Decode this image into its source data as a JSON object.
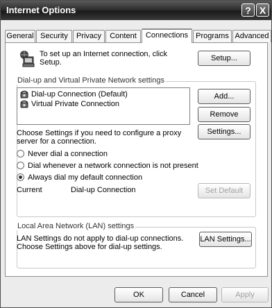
{
  "window": {
    "title": "Internet Options",
    "help_label": "?",
    "close_label": "X"
  },
  "tabs": [
    {
      "label": "General"
    },
    {
      "label": "Security"
    },
    {
      "label": "Privacy"
    },
    {
      "label": "Content"
    },
    {
      "label": "Connections",
      "active": true
    },
    {
      "label": "Programs"
    },
    {
      "label": "Advanced"
    }
  ],
  "setup": {
    "text_line1": "To set up an Internet connection, click",
    "text_line2": "Setup.",
    "button_label": "Setup..."
  },
  "dialup": {
    "group_label": "Dial-up and Virtual Private Network settings",
    "connections": [
      {
        "label": "Dial-up Connection (Default)",
        "selected": true
      },
      {
        "label": "Virtual Private Connection",
        "selected": false
      }
    ],
    "add_label": "Add...",
    "remove_label": "Remove",
    "settings_label": "Settings...",
    "proxy_line1": "Choose Settings if you need to configure a proxy",
    "proxy_line2": "server for a connection.",
    "radios": [
      {
        "label": "Never dial a connection",
        "checked": false
      },
      {
        "label": "Dial whenever a network connection is not present",
        "checked": false
      },
      {
        "label": "Always dial my default connection",
        "checked": true
      }
    ],
    "current_label": "Current",
    "current_value": "Dial-up Connection",
    "set_default_label": "Set Default"
  },
  "lan": {
    "group_label": "Local Area Network (LAN) settings",
    "text_line1": "LAN Settings do not apply to dial-up connections.",
    "text_line2": "Choose Settings above for dial-up settings.",
    "button_label": "LAN Settings..."
  },
  "footer": {
    "ok_label": "OK",
    "cancel_label": "Cancel",
    "apply_label": "Apply"
  }
}
